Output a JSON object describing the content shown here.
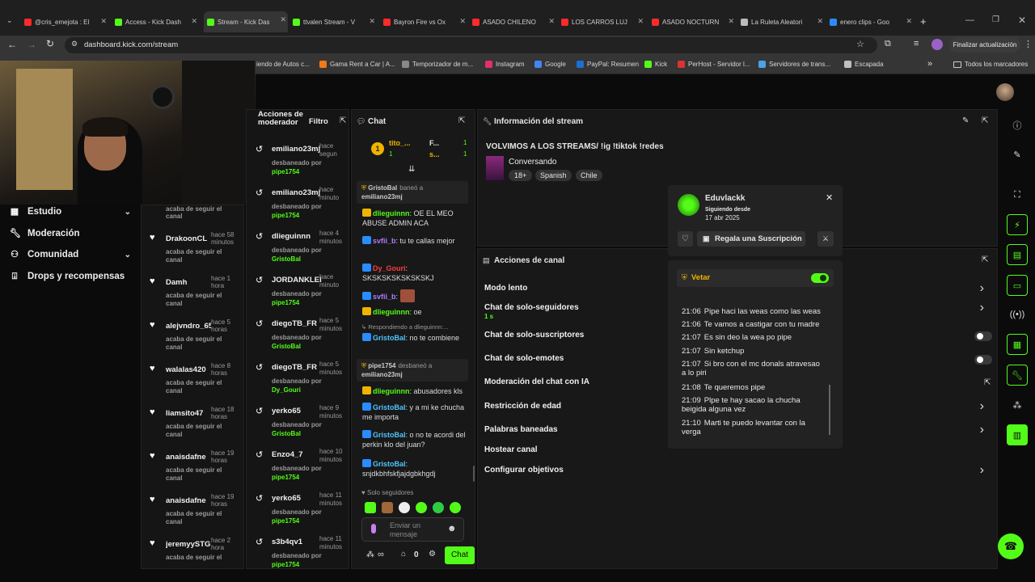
{
  "browser": {
    "tabs": [
      {
        "label": "@cris_emejota : El",
        "color": "#ff2a2a"
      },
      {
        "label": "Access - Kick Dash",
        "color": "#53fc18"
      },
      {
        "label": "Stream - Kick Das",
        "color": "#53fc18",
        "active": true
      },
      {
        "label": "ttvalen Stream - V",
        "color": "#53fc18"
      },
      {
        "label": "Bayron Fire vs Ox",
        "color": "#ff2a2a"
      },
      {
        "label": "ASADO CHILENO",
        "color": "#ff2a2a"
      },
      {
        "label": "LOS CARROS LUJ",
        "color": "#ff2a2a"
      },
      {
        "label": "ASADO NOCTURN",
        "color": "#ff2a2a"
      },
      {
        "label": "La Ruleta Aleatori",
        "color": "#bbbbbb"
      },
      {
        "label": "enero clips - Goo",
        "color": "#2a8cff"
      }
    ],
    "new_tab": "+",
    "url": "dashboard.kick.com/stream",
    "update_button": "Finalizar actualización",
    "bookmarks": [
      {
        "label": "iendo de Autos c...",
        "color": "transparent"
      },
      {
        "label": "Gama Rent a Car | A...",
        "color": "#f07a1a"
      },
      {
        "label": "Temporizador de m...",
        "color": "#888"
      },
      {
        "label": "Instagram",
        "color": "#e1306c"
      },
      {
        "label": "Google",
        "color": "#4285f4"
      },
      {
        "label": "PayPal: Resumen",
        "color": "#1c6fd6"
      },
      {
        "label": "Kick",
        "color": "#53fc18"
      },
      {
        "label": "PerHost - Servidor l...",
        "color": "#d33"
      },
      {
        "label": "Servidores de trans...",
        "color": "#4aa3e6"
      },
      {
        "label": "Escapada",
        "color": "#c0c0c0"
      }
    ],
    "bookmarks_overflow": "»",
    "all_bookmarks": "Todos los marcadores"
  },
  "sidebar": {
    "items": [
      {
        "label": "Estudio",
        "icon": "studio-icon",
        "expand": true
      },
      {
        "label": "Moderación",
        "icon": "wrench-icon"
      },
      {
        "label": "Comunidad",
        "icon": "community-icon",
        "expand": true
      },
      {
        "label": "Drops y recompensas",
        "icon": "drops-icon"
      }
    ]
  },
  "followers": {
    "items": [
      {
        "partial": true,
        "action": "acaba de seguir el",
        "action2": "canal"
      },
      {
        "name": "DrakoonCL",
        "time": "hace 58 minutos",
        "action": "acaba de seguir el canal"
      },
      {
        "name": "Damh",
        "time": "hace 1 hora",
        "action": "acaba de seguir el canal"
      },
      {
        "name": "alejvndro_65",
        "time": "hace 5 horas",
        "action": "acaba de seguir el canal"
      },
      {
        "name": "walalas420",
        "time": "hace 8 horas",
        "action": "acaba de seguir el canal"
      },
      {
        "name": "liamsito47",
        "time": "hace 18 horas",
        "action": "acaba de seguir el canal"
      },
      {
        "name": "anaisdafne",
        "time": "hace 19 horas",
        "action": "acaba de seguir el canal"
      },
      {
        "name": "anaisdafne",
        "time": "hace 19 horas",
        "action": "acaba de seguir el canal"
      },
      {
        "name": "jeremyySTGOO",
        "time": "hace 2 hora",
        "action": "acaba de seguir el"
      }
    ]
  },
  "modactions": {
    "title": "Acciones de moderador",
    "filter": "Filtro",
    "items": [
      {
        "name": "emiliano23mj",
        "time": "hace segun",
        "action": "desbaneado por",
        "by": "pipe1754"
      },
      {
        "name": "emiliano23mj",
        "time": "hace minuto",
        "action": "desbaneado por",
        "by": "pipe1754"
      },
      {
        "name": "dlieguinnn",
        "time": "hace 4 minutos",
        "action": "desbaneado por",
        "by": "GristoBal"
      },
      {
        "name": "JORDANKLEIN",
        "time": "hace minuto",
        "action": "desbaneado por",
        "by": "pipe1754"
      },
      {
        "name": "diegoTB_FR",
        "time": "hace 5 minutos",
        "action": "desbaneado por",
        "by": "GristoBal"
      },
      {
        "name": "diegoTB_FR",
        "time": "hace 5 minutos",
        "action": "desbaneado por",
        "by": "Dy_Gouri"
      },
      {
        "name": "yerko65",
        "time": "hace 9 minutos",
        "action": "desbaneado por",
        "by": "GristoBal"
      },
      {
        "name": "Enzo4_7",
        "time": "hace 10 minutos",
        "action": "desbaneado por",
        "by": "pipe1754"
      },
      {
        "name": "yerko65",
        "time": "hace 11 minutos",
        "action": "desbaneado por",
        "by": "pipe1754"
      },
      {
        "name": "s3b4qv1",
        "time": "hace 11 minutos",
        "action": "desbaneado por",
        "by": "pipe1754"
      }
    ]
  },
  "chat": {
    "title": "Chat",
    "top": {
      "rank": "1",
      "user1": "tito_...",
      "count1": "1",
      "user2": "F...",
      "count2": "1",
      "user3": "s...",
      "count3": "1"
    },
    "messages": [
      {
        "type": "sys",
        "user": "GristoBal",
        "text": "baneó a",
        "target": "emiliano23mj"
      },
      {
        "user": "dlieguinnn",
        "color": "#53fc18",
        "text": ": OE EL MEO ABUSE ADMIN ACA"
      },
      {
        "user": "svfii_b",
        "color": "#b07cff",
        "text": ": tu te callas mejor"
      },
      {
        "user": "Dy_Gouri",
        "color": "#ff3b3b",
        "text": ": SKSKSKSKSKSKSKJ"
      },
      {
        "user": "svfii_b",
        "color": "#b07cff",
        "text": ":"
      },
      {
        "user": "dlieguinnn",
        "color": "#53fc18",
        "text": ": oe"
      },
      {
        "type": "reply",
        "text": "Respondiendo a dlieguinnn:..."
      },
      {
        "user": "GristoBal",
        "color": "#4fc3ff",
        "text": ": no te combiene"
      },
      {
        "type": "sys",
        "user": "pipe1754",
        "text": "desbaneó a",
        "target": "emiliano23mj"
      },
      {
        "user": "dlieguinnn",
        "color": "#53fc18",
        "text": ": abusadores kls"
      },
      {
        "user": "GristoBal",
        "color": "#4fc3ff",
        "text": ": y a mi ke chucha me importa"
      },
      {
        "user": "GristoBal",
        "color": "#4fc3ff",
        "text": ": o no te acordi del perkin klo del juan?"
      },
      {
        "user": "GristoBal",
        "color": "#4fc3ff",
        "text": ": snjdkbhfskfjajdgbkhgdj"
      }
    ],
    "mode": "Solo seguidores",
    "placeholder": "Enviar un mensaje",
    "bottom_count": "0",
    "send": "Chat",
    "infinity": "∞"
  },
  "stream_info": {
    "title": "Información del stream",
    "stream_title": "VOLVIMOS A LOS STREAMS/ !ig !tiktok !redes",
    "category": "Conversando",
    "tags": [
      "18+",
      "Spanish",
      "Chile"
    ]
  },
  "channel_actions": {
    "title": "Acciones de canal",
    "items": [
      {
        "label": "Modo lento",
        "arrow": true
      },
      {
        "label": "Chat de solo-seguidores",
        "sub": "1 s",
        "arrow": true
      },
      {
        "label": "Chat de solo-suscriptores",
        "toggle": "off"
      },
      {
        "label": "Chat de solo-emotes",
        "toggle": "off"
      },
      {
        "label": "Moderación del chat con IA",
        "ext": true
      },
      {
        "label": "Restricción de edad",
        "arrow": true
      },
      {
        "label": "Palabras baneadas",
        "arrow": true
      },
      {
        "label": "Hostear canal"
      },
      {
        "label": "Configurar objetivos",
        "arrow": true
      }
    ]
  },
  "user_card": {
    "name": "Eduvlackk",
    "following_label": "Siguiendo desde",
    "following_date": "17 abr 2025",
    "gift_button": "Regala una Suscripción",
    "vip_label": "Vetar",
    "vip_on": true,
    "messages": [
      {
        "time": "21:06",
        "text": "Pipe haci las weas como las weas"
      },
      {
        "time": "21:06",
        "text": "Te vamos a castigar con tu madre"
      },
      {
        "time": "21:07",
        "text": "Es sin deo la wea po pipe"
      },
      {
        "time": "21:07",
        "text": "Sin ketchup"
      },
      {
        "time": "21:07",
        "text": "Si bro con el mc donals atravesao a lo piri"
      },
      {
        "time": "21:08",
        "text": "Te queremos pipe"
      },
      {
        "time": "21:09",
        "text": "Plpe te hay sacao la chucha beigida alguna vez"
      },
      {
        "time": "21:10",
        "text": "Marti te puedo levantar con la verga"
      }
    ]
  },
  "colors": {
    "accent": "#53fc18",
    "panel": "#181818",
    "bg": "#0b0b0b"
  }
}
